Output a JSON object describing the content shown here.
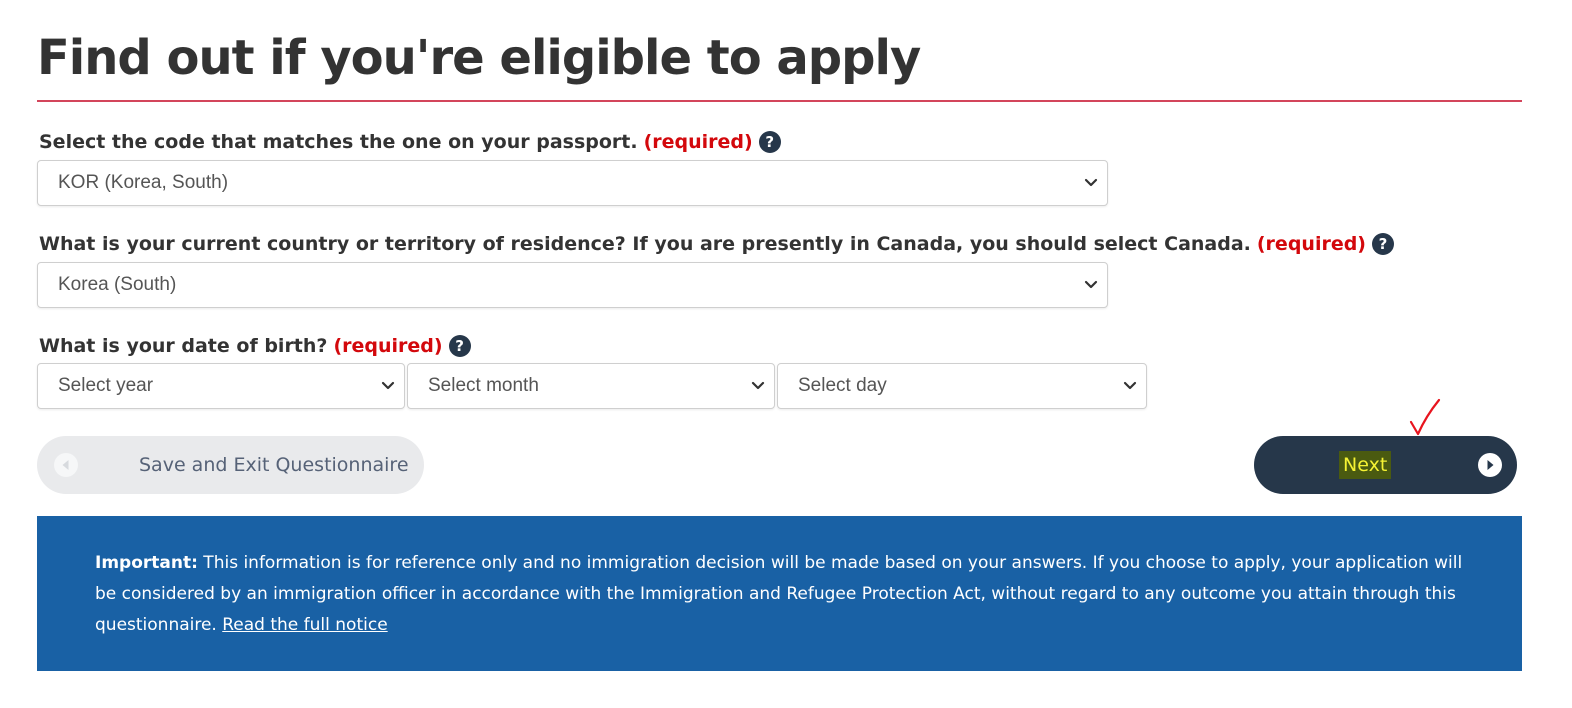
{
  "page": {
    "title": "Find out if you're eligible to apply"
  },
  "fields": {
    "passport": {
      "label": "Select the code that matches the one on your passport.",
      "required": "(required)",
      "help": "?",
      "value": "KOR (Korea, South)"
    },
    "residence": {
      "label": "What is your current country or territory of residence? If you are presently in Canada, you should select Canada.",
      "required": "(required)",
      "help": "?",
      "value": "Korea (South)"
    },
    "dob": {
      "label": "What is your date of birth?",
      "required": "(required)",
      "help": "?",
      "year_placeholder": "Select year",
      "month_placeholder": "Select month",
      "day_placeholder": "Select day"
    }
  },
  "buttons": {
    "save_exit": "Save and Exit Questionnaire",
    "next": "Next"
  },
  "notice": {
    "strong": "Important:",
    "text": " This information is for reference only and no immigration decision will be made based on your answers. If you choose to apply, your application will be considered by an immigration officer in accordance with the Immigration and Refugee Protection Act, without regard to any outcome you attain through this questionnaire. ",
    "link": "Read the full notice"
  },
  "colors": {
    "accent_red": "#d3080c",
    "rule_red": "#d3455b",
    "navy": "#26374a",
    "notice_blue": "#1961a5",
    "annotation_red": "#e8141e",
    "highlight_yellow": "#f5f233"
  },
  "icons": {
    "help": "question-circle-icon",
    "dropdown": "chevron-down-icon",
    "back": "circle-arrow-left-icon",
    "forward": "circle-arrow-right-icon",
    "annotation": "check-mark-icon"
  }
}
